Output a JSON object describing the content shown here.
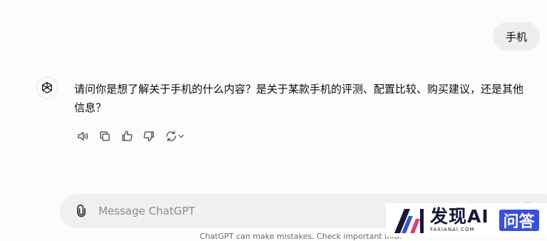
{
  "conversation": {
    "user_message": "手机",
    "assistant_reply": "请问你是想了解关于手机的什么内容？是关于某款手机的评测、配置比较、购买建议，还是其他信息？"
  },
  "message_actions": [
    {
      "icon": "speaker-icon",
      "label": "Read aloud"
    },
    {
      "icon": "copy-icon",
      "label": "Copy"
    },
    {
      "icon": "thumbs-up-icon",
      "label": "Good response"
    },
    {
      "icon": "thumbs-down-icon",
      "label": "Bad response"
    },
    {
      "icon": "regenerate-icon",
      "label": "Regenerate"
    }
  ],
  "composer": {
    "placeholder": "Message ChatGPT",
    "value": ""
  },
  "footer": {
    "disclaimer": "ChatGPT can make mistakes. Check important info."
  },
  "watermark": {
    "title": "发现AI",
    "subtitle": "FAXIANAI.COM",
    "badge": "问答"
  },
  "colors": {
    "background": "#fcfcfb",
    "user_bubble": "#eeeeed",
    "composer": "#f0f0ef",
    "watermark_accent": "#3550e8"
  }
}
